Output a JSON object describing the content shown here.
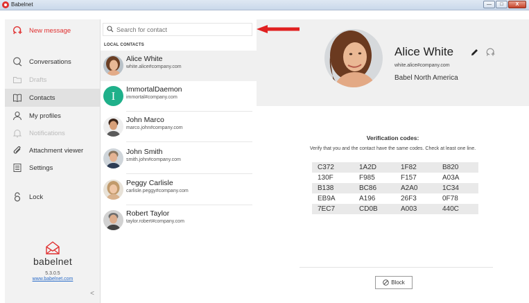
{
  "window": {
    "title": "Babelnet",
    "minimize": "—",
    "maximize": "□",
    "close": "X"
  },
  "sidebar": {
    "items": [
      {
        "label": "New message",
        "icon": "new-message-icon"
      },
      {
        "label": "Conversations",
        "icon": "chat-bubble-icon"
      },
      {
        "label": "Drafts",
        "icon": "folder-icon",
        "disabled": true
      },
      {
        "label": "Contacts",
        "icon": "book-icon",
        "active": true
      },
      {
        "label": "My profiles",
        "icon": "user-icon"
      },
      {
        "label": "Notifications",
        "icon": "bell-icon",
        "disabled": true
      },
      {
        "label": "Attachment viewer",
        "icon": "paperclip-icon"
      },
      {
        "label": "Settings",
        "icon": "settings-list-icon"
      },
      {
        "label": "Lock",
        "icon": "lock-icon"
      }
    ],
    "brand": {
      "name": "babelnet",
      "version": "5.3.0.5",
      "link": "www.babelnet.com"
    },
    "collapse": "<"
  },
  "search": {
    "placeholder": "Search for contact"
  },
  "contacts": {
    "section_header": "LOCAL CONTACTS",
    "list": [
      {
        "name": "Alice White",
        "email": "white.alice#company.com",
        "avatar": "photo",
        "selected": true
      },
      {
        "name": "ImmortalDaemon",
        "email": "immortal#company.com",
        "avatar": "initial",
        "initial": "I",
        "color": "#1fb08a"
      },
      {
        "name": "John Marco",
        "email": "marco.john#company.com",
        "avatar": "photo"
      },
      {
        "name": "John Smith",
        "email": "smith.john#company.com",
        "avatar": "photo"
      },
      {
        "name": "Peggy Carlisle",
        "email": "carlisle.peggy#company.com",
        "avatar": "photo"
      },
      {
        "name": "Robert Taylor",
        "email": "taylor.robert#company.com",
        "avatar": "photo"
      }
    ]
  },
  "detail": {
    "name": "Alice White",
    "email": "white.alice#company.com",
    "organization": "Babel North America",
    "verification_title": "Verification codes:",
    "verification_text": "Verify that you and the contact have the same codes. Check at least one line.",
    "codes": [
      [
        "C372",
        "1A2D",
        "1F82",
        "B820"
      ],
      [
        "130F",
        "F985",
        "F157",
        "A03A"
      ],
      [
        "B138",
        "BC86",
        "A2A0",
        "1C34"
      ],
      [
        "EB9A",
        "A196",
        "26F3",
        "0F78"
      ],
      [
        "7EC7",
        "CD0B",
        "A003",
        "440C"
      ]
    ],
    "block_label": "Block"
  },
  "colors": {
    "accent": "#e03030",
    "annotation_arrow": "#e02020",
    "sidebar_bg": "#f2f2f2"
  }
}
